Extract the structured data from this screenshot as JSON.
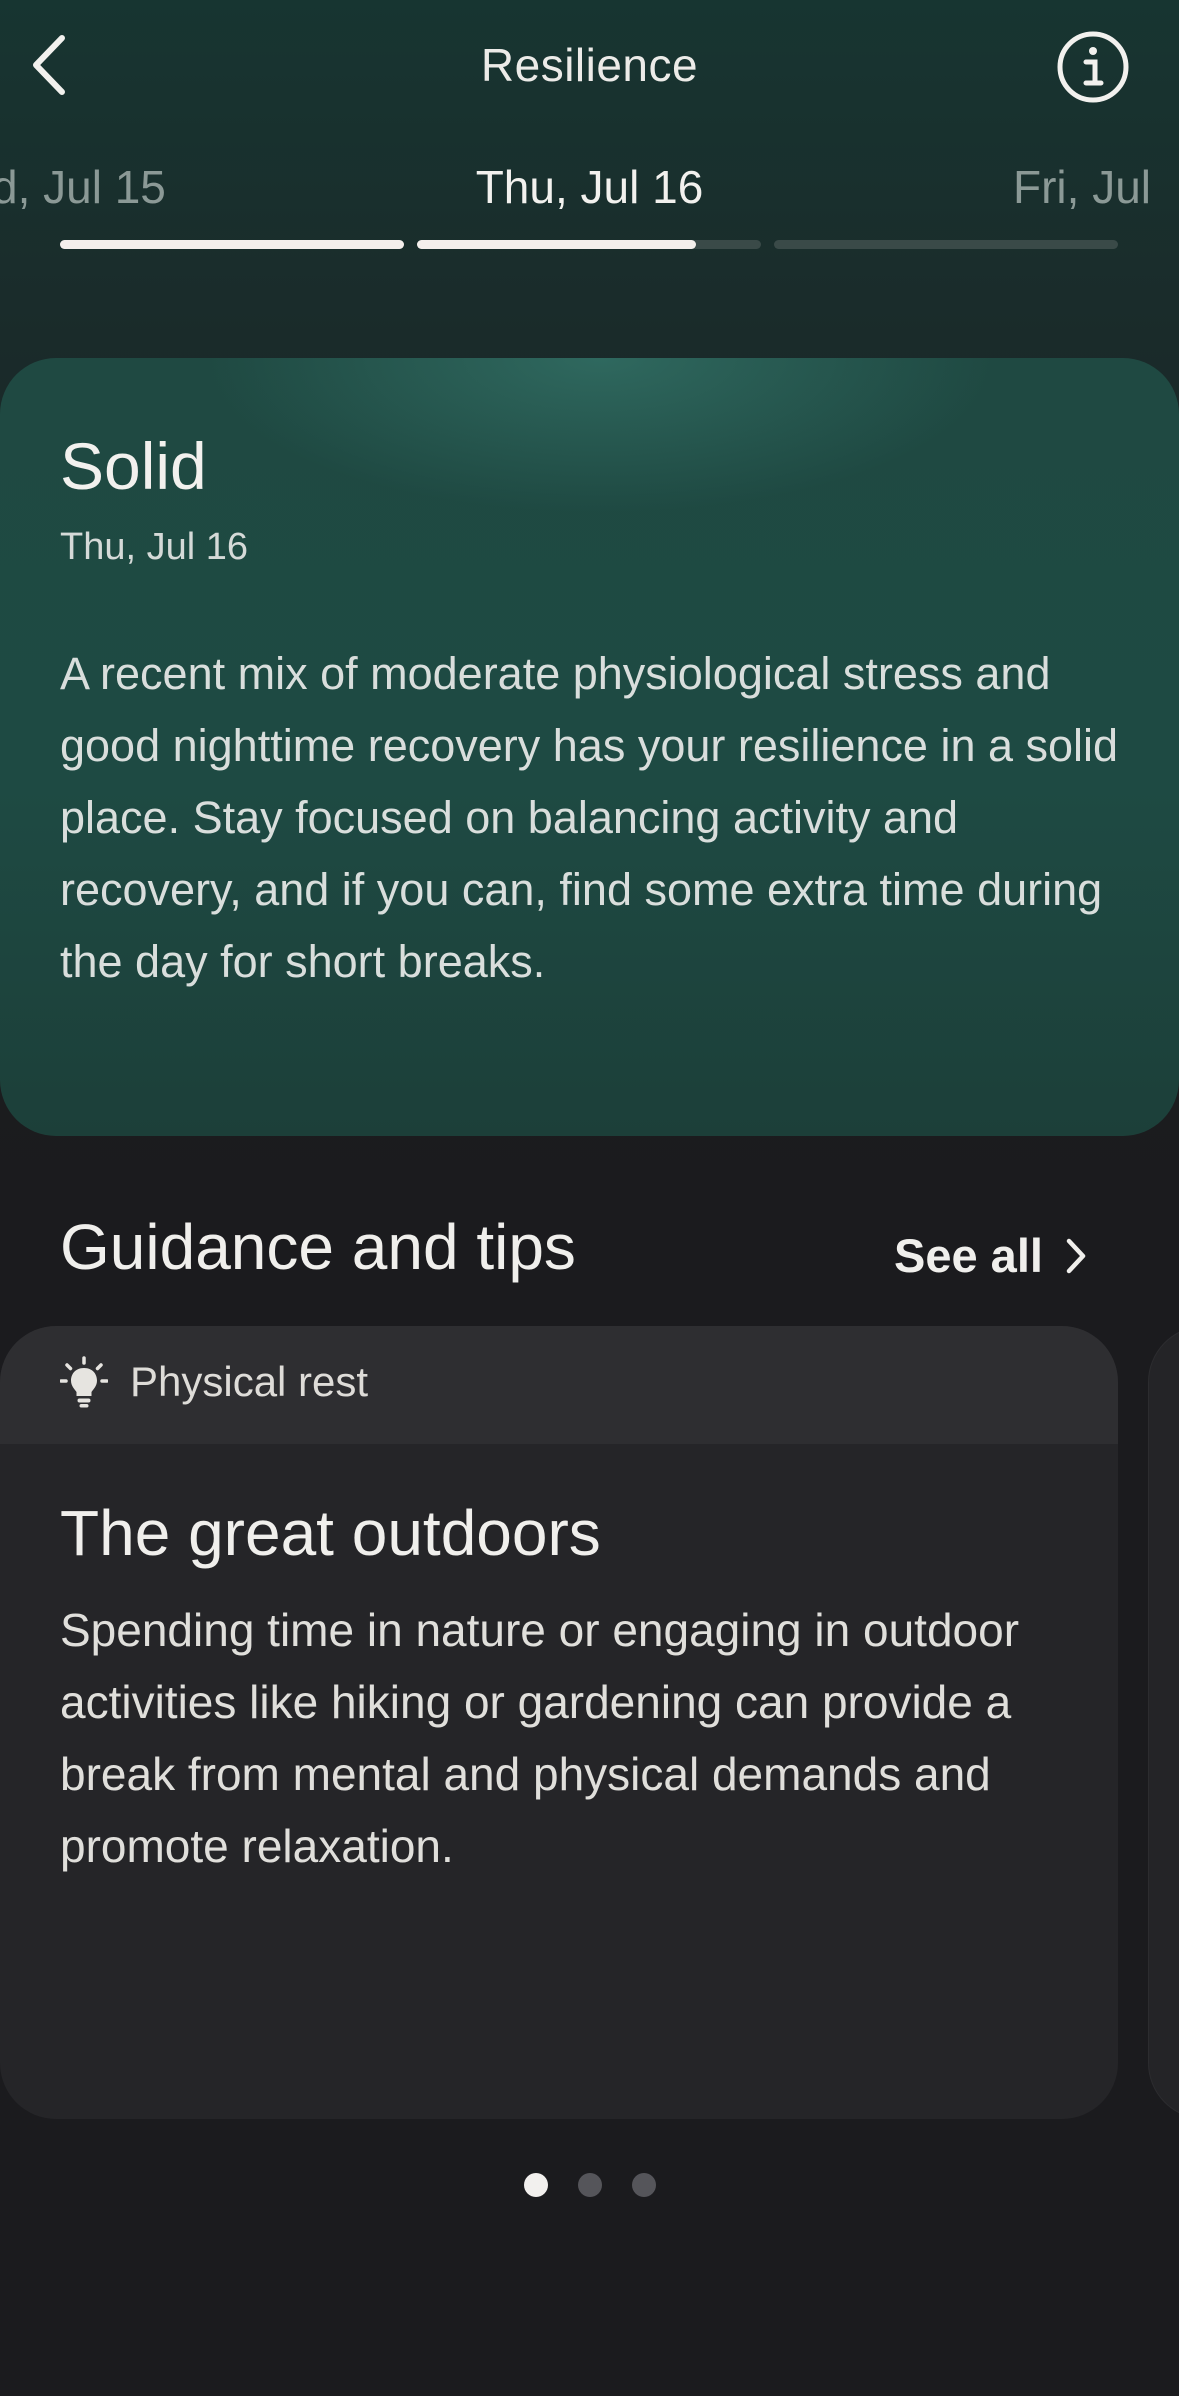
{
  "header": {
    "title": "Resilience",
    "back_icon": "chevron-left-icon",
    "info_icon": "info-circle-icon"
  },
  "date_selector": {
    "previous": "d, Jul 15",
    "current": "Thu, Jul 16",
    "next": "Fri, Jul"
  },
  "resilience_card": {
    "level": "Solid",
    "date": "Thu, Jul 16",
    "description": "A recent mix of moderate physiological stress and good nighttime recovery has your resilience in a solid place. Stay focused on balancing activity and recovery, and if you can, find some extra time during the day for short breaks."
  },
  "guidance": {
    "title": "Guidance and tips",
    "see_all": "See all",
    "tips": [
      {
        "category": "Physical rest",
        "category_icon": "lightbulb-icon",
        "title": "The great outdoors",
        "body": "Spending time in nature or engaging in outdoor activities like hiking or gardening can provide a break from mental and physical demands and promote relaxation."
      }
    ],
    "pager": {
      "count": 3,
      "active": 1
    }
  },
  "colors": {
    "background": "#1b1b1e",
    "card_teal": "#1e4a43",
    "tip_card": "#252528",
    "text": "#ecebe8"
  }
}
